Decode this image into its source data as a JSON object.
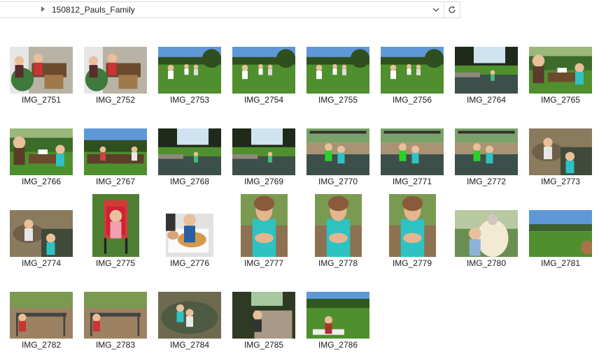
{
  "address_bar": {
    "path": "150812_Pauls_Family",
    "dropdown_icon": "chevron-down-icon",
    "refresh_icon": "refresh-icon"
  },
  "files": [
    {
      "name": "IMG_2751",
      "orientation": "landscape",
      "scene": "indoor"
    },
    {
      "name": "IMG_2752",
      "orientation": "landscape",
      "scene": "indoor"
    },
    {
      "name": "IMG_2753",
      "orientation": "landscape",
      "scene": "park"
    },
    {
      "name": "IMG_2754",
      "orientation": "landscape",
      "scene": "park"
    },
    {
      "name": "IMG_2755",
      "orientation": "landscape",
      "scene": "park"
    },
    {
      "name": "IMG_2756",
      "orientation": "landscape",
      "scene": "park"
    },
    {
      "name": "IMG_2764",
      "orientation": "landscape",
      "scene": "pond"
    },
    {
      "name": "IMG_2765",
      "orientation": "landscape",
      "scene": "picnic"
    },
    {
      "name": "IMG_2766",
      "orientation": "landscape",
      "scene": "picnic"
    },
    {
      "name": "IMG_2767",
      "orientation": "landscape",
      "scene": "picnic-wide"
    },
    {
      "name": "IMG_2768",
      "orientation": "landscape",
      "scene": "pond"
    },
    {
      "name": "IMG_2769",
      "orientation": "landscape",
      "scene": "pond"
    },
    {
      "name": "IMG_2770",
      "orientation": "landscape",
      "scene": "creek"
    },
    {
      "name": "IMG_2771",
      "orientation": "landscape",
      "scene": "creek"
    },
    {
      "name": "IMG_2772",
      "orientation": "landscape",
      "scene": "creek"
    },
    {
      "name": "IMG_2773",
      "orientation": "landscape",
      "scene": "rocks"
    },
    {
      "name": "IMG_2774",
      "orientation": "landscape",
      "scene": "rocks"
    },
    {
      "name": "IMG_2775",
      "orientation": "portrait",
      "scene": "stroller"
    },
    {
      "name": "IMG_2776",
      "orientation": "landscape-tall",
      "scene": "pizza"
    },
    {
      "name": "IMG_2777",
      "orientation": "portrait",
      "scene": "girl"
    },
    {
      "name": "IMG_2778",
      "orientation": "portrait",
      "scene": "girl"
    },
    {
      "name": "IMG_2779",
      "orientation": "portrait",
      "scene": "girl"
    },
    {
      "name": "IMG_2780",
      "orientation": "landscape",
      "scene": "grandma"
    },
    {
      "name": "IMG_2781",
      "orientation": "landscape",
      "scene": "field"
    },
    {
      "name": "IMG_2782",
      "orientation": "landscape",
      "scene": "bridge"
    },
    {
      "name": "IMG_2783",
      "orientation": "landscape",
      "scene": "bridge"
    },
    {
      "name": "IMG_2784",
      "orientation": "landscape",
      "scene": "water"
    },
    {
      "name": "IMG_2785",
      "orientation": "landscape",
      "scene": "path"
    },
    {
      "name": "IMG_2786",
      "orientation": "landscape",
      "scene": "lawn"
    }
  ],
  "colors": {
    "sky": "#5f98d8",
    "grass": "#4f8f2e",
    "tree": "#2f4f1e",
    "water": "#3d4f4a",
    "indoor_wall": "#c9c4b9",
    "rock": "#8a7a5e",
    "shirt_teal": "#2ec2c2"
  }
}
